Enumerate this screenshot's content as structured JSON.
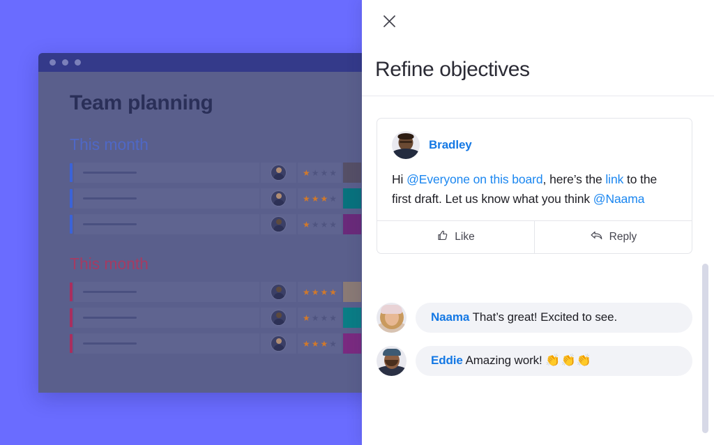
{
  "theme": {
    "background_purple": "#6a6cff",
    "panel_white": "#ffffff",
    "link_blue": "#1a86f0",
    "name_blue": "#1478e4",
    "bubble_grey": "#f2f3f7",
    "board_dim": "#5a5f8c",
    "board_titlebar": "#343a8a",
    "star_on": "#d1792b",
    "star_off": "#4f5480"
  },
  "board": {
    "window_title_dots": 3,
    "title": "Team planning",
    "groups": [
      {
        "label": "This month",
        "accent": "#3b63d8",
        "rows": [
          {
            "stars_filled": 1,
            "stars_total": 4,
            "color": "#554f66"
          },
          {
            "stars_filled": 3,
            "stars_total": 4,
            "color": "#08727d"
          },
          {
            "stars_filled": 1,
            "stars_total": 4,
            "color": "#6a2a7a"
          }
        ]
      },
      {
        "label": "This month",
        "accent": "#aa2e5e",
        "rows": [
          {
            "stars_filled": 4,
            "stars_total": 4,
            "color": "#8a7a75"
          },
          {
            "stars_filled": 1,
            "stars_total": 4,
            "color": "#0a7d85"
          },
          {
            "stars_filled": 3,
            "stars_total": 4,
            "color": "#7a2a80"
          }
        ]
      }
    ]
  },
  "panel": {
    "close_icon": "close-icon",
    "title": "Refine objectives",
    "comment": {
      "author": "Bradley",
      "avatar": "bradley-avatar",
      "text_parts": [
        {
          "type": "text",
          "value": "Hi "
        },
        {
          "type": "mention",
          "value": "@Everyone on this board"
        },
        {
          "type": "text",
          "value": ", here’s the "
        },
        {
          "type": "link",
          "value": "link"
        },
        {
          "type": "text",
          "value": " to the first draft. Let us know what you think "
        },
        {
          "type": "mention",
          "value": "@Naama"
        }
      ],
      "full_text": "Hi @Everyone on this board, here’s the link to the first draft. Let us know what you think @Naama",
      "actions": [
        {
          "icon": "thumbs-up-icon",
          "label": "Like"
        },
        {
          "icon": "reply-arrow-icon",
          "label": "Reply"
        }
      ]
    },
    "replies": [
      {
        "avatar": "naama-avatar",
        "author": "Naama",
        "message": "That’s great! Excited to see.",
        "emoji": ""
      },
      {
        "avatar": "eddie-avatar",
        "author": "Eddie",
        "message": "Amazing work!",
        "emoji": "👏👏👏"
      }
    ],
    "scrollbar": {
      "name": "panel-scrollbar"
    }
  }
}
